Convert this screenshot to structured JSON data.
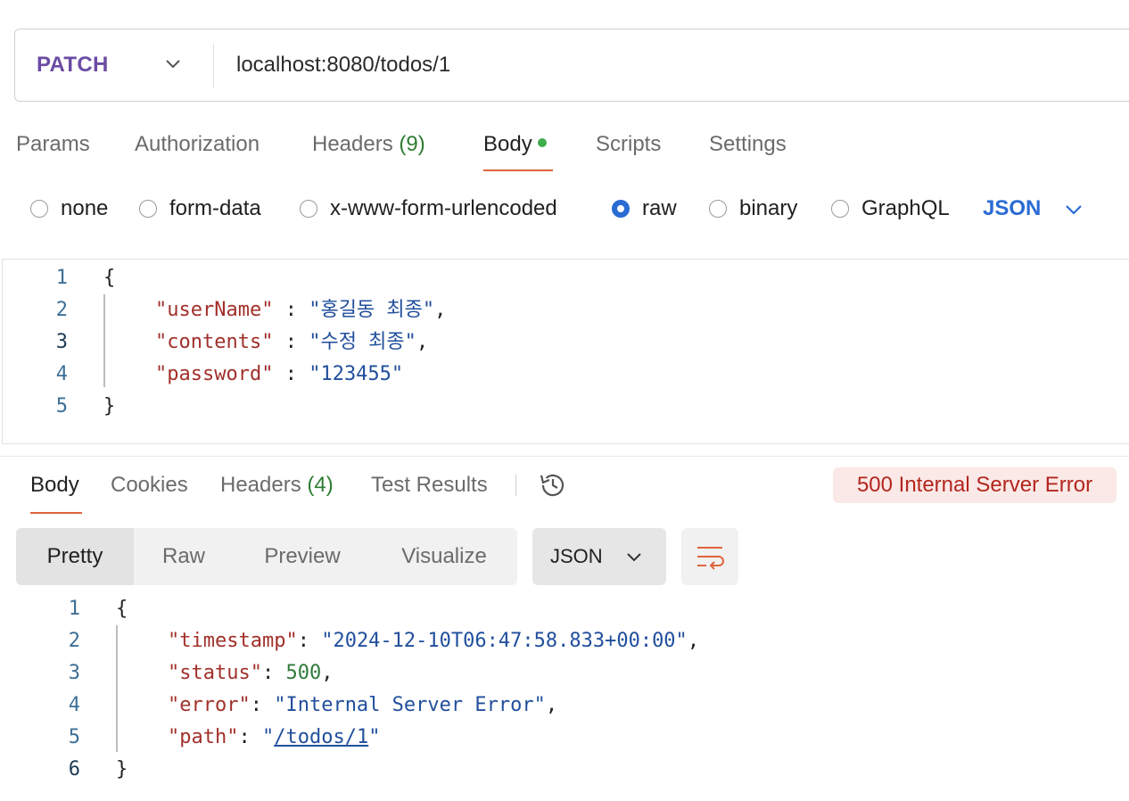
{
  "request": {
    "method": "PATCH",
    "url": "localhost:8080/todos/1",
    "tabs": {
      "params": "Params",
      "authorization": "Authorization",
      "headers": "Headers",
      "headers_count": "(9)",
      "body": "Body",
      "scripts": "Scripts",
      "settings": "Settings"
    },
    "body_types": {
      "none": "none",
      "form_data": "form-data",
      "urlencoded": "x-www-form-urlencoded",
      "raw": "raw",
      "binary": "binary",
      "graphql": "GraphQL"
    },
    "selected_body_type": "raw",
    "raw_format": "JSON",
    "body_lines": {
      "n1": "1",
      "n2": "2",
      "n3": "3",
      "n4": "4",
      "n5": "5",
      "open": "{",
      "k1": "\"userName\"",
      "v1": "\"홍길동 최종\"",
      "k2": "\"contents\"",
      "v2": "\"수정 최종\"",
      "k3": "\"password\"",
      "v3": "\"123455\"",
      "close": "}"
    }
  },
  "response": {
    "tabs": {
      "body": "Body",
      "cookies": "Cookies",
      "headers": "Headers",
      "headers_count": "(4)",
      "test_results": "Test Results"
    },
    "status": "500 Internal Server Error",
    "views": {
      "pretty": "Pretty",
      "raw": "Raw",
      "preview": "Preview",
      "visualize": "Visualize"
    },
    "format": "JSON",
    "body_lines": {
      "n1": "1",
      "n2": "2",
      "n3": "3",
      "n4": "4",
      "n5": "5",
      "n6": "6",
      "open": "{",
      "k1": "\"timestamp\"",
      "v1": "\"2024-12-10T06:47:58.833+00:00\"",
      "k2": "\"status\"",
      "v2": "500",
      "k3": "\"error\"",
      "v3": "\"Internal Server Error\"",
      "k4": "\"path\"",
      "v4_q1": "\"",
      "v4_link": "/todos/1",
      "v4_q2": "\"",
      "close": "}"
    }
  },
  "icons": {
    "method_dropdown": "chevron-down-icon",
    "format_dropdown": "chevron-down-icon",
    "history": "history-icon",
    "wrap": "wrap-lines-icon"
  },
  "colors": {
    "method": "#6b4ca3",
    "accent_underline": "#e0643c",
    "status_text": "#b3261e",
    "status_bg": "#fbe9e7",
    "radio_selected": "#2a6bd3",
    "json_key": "#a1302a",
    "json_string": "#214f9c",
    "json_number": "#2f7a3b"
  }
}
